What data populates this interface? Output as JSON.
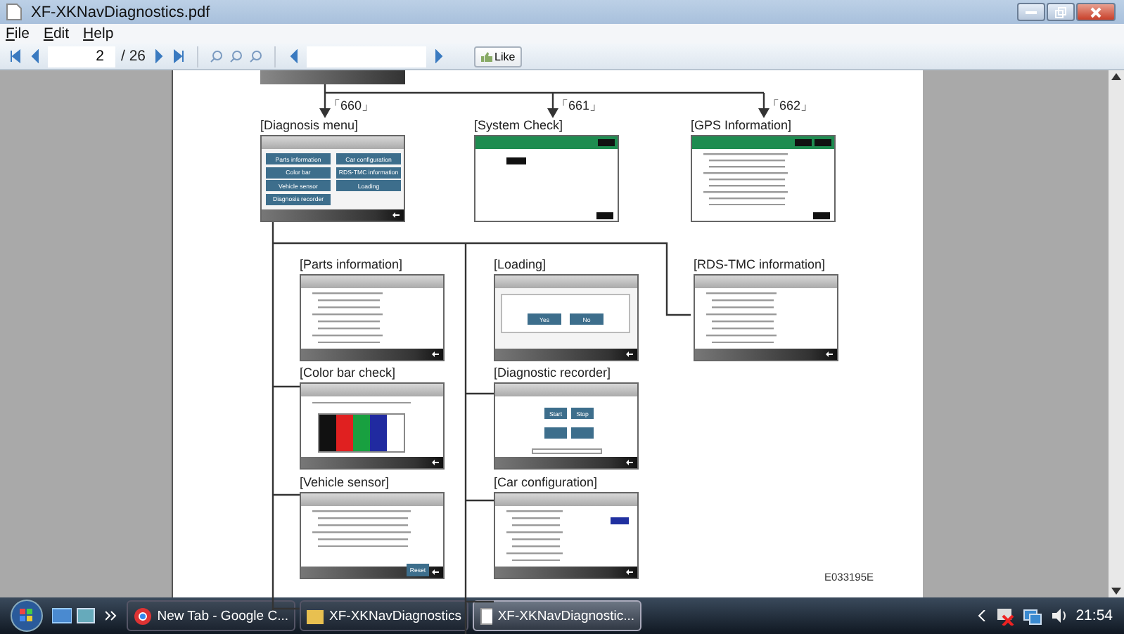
{
  "window": {
    "title": "XF-XKNavDiagnostics.pdf"
  },
  "menu": [
    {
      "label": "File"
    },
    {
      "label": "Edit"
    },
    {
      "label": "Help"
    }
  ],
  "toolbar": {
    "page": "2",
    "total": "/ 26",
    "like": "Like"
  },
  "diagram": {
    "branch_labels": [
      "「660」",
      "「661」",
      "「662」"
    ],
    "nodes": [
      {
        "kind": "menu",
        "title": "[Diagnosis menu]",
        "buttons": [
          {
            "label": "Parts information"
          },
          {
            "label": "Car configuration"
          },
          {
            "label": "Color bar"
          },
          {
            "label": "RDS-TMC information"
          },
          {
            "label": "Vehicle sensor"
          },
          {
            "label": "Loading"
          },
          {
            "label": "Diagnosis recorder"
          }
        ]
      },
      {
        "kind": "check",
        "title": "[System Check]"
      },
      {
        "kind": "gps",
        "title": "[GPS Information]"
      },
      {
        "kind": "list",
        "title": "[Parts information]"
      },
      {
        "kind": "dialog",
        "title": "[Loading]",
        "buttons": [
          {
            "label": "Yes"
          },
          {
            "label": "No"
          }
        ]
      },
      {
        "kind": "list",
        "title": "[RDS-TMC information]"
      },
      {
        "kind": "colorbar",
        "title": "[Color bar check]",
        "bars": [
          {
            "color": "#111111"
          },
          {
            "color": "#e02020"
          },
          {
            "color": "#18a040"
          },
          {
            "color": "#202aa0"
          },
          {
            "color": "#ffffff"
          }
        ]
      },
      {
        "kind": "recorder",
        "title": "[Diagnostic recorder]",
        "buttons": [
          {
            "label": "Start"
          },
          {
            "label": "Stop"
          }
        ]
      },
      {
        "kind": "sensor",
        "title": "[Vehicle sensor]",
        "buttons": [
          {
            "label": "Reset"
          }
        ]
      },
      {
        "kind": "config",
        "title": "[Car configuration]"
      }
    ],
    "code": "E033195E"
  },
  "taskbar": {
    "items": [
      {
        "label": "New Tab - Google C...",
        "kind": "browser",
        "selected": false
      },
      {
        "label": "XF-XKNavDiagnostics",
        "kind": "folder",
        "selected": false
      },
      {
        "label": "XF-XKNavDiagnostic...",
        "kind": "document",
        "selected": true
      }
    ],
    "clock": "21:54"
  }
}
